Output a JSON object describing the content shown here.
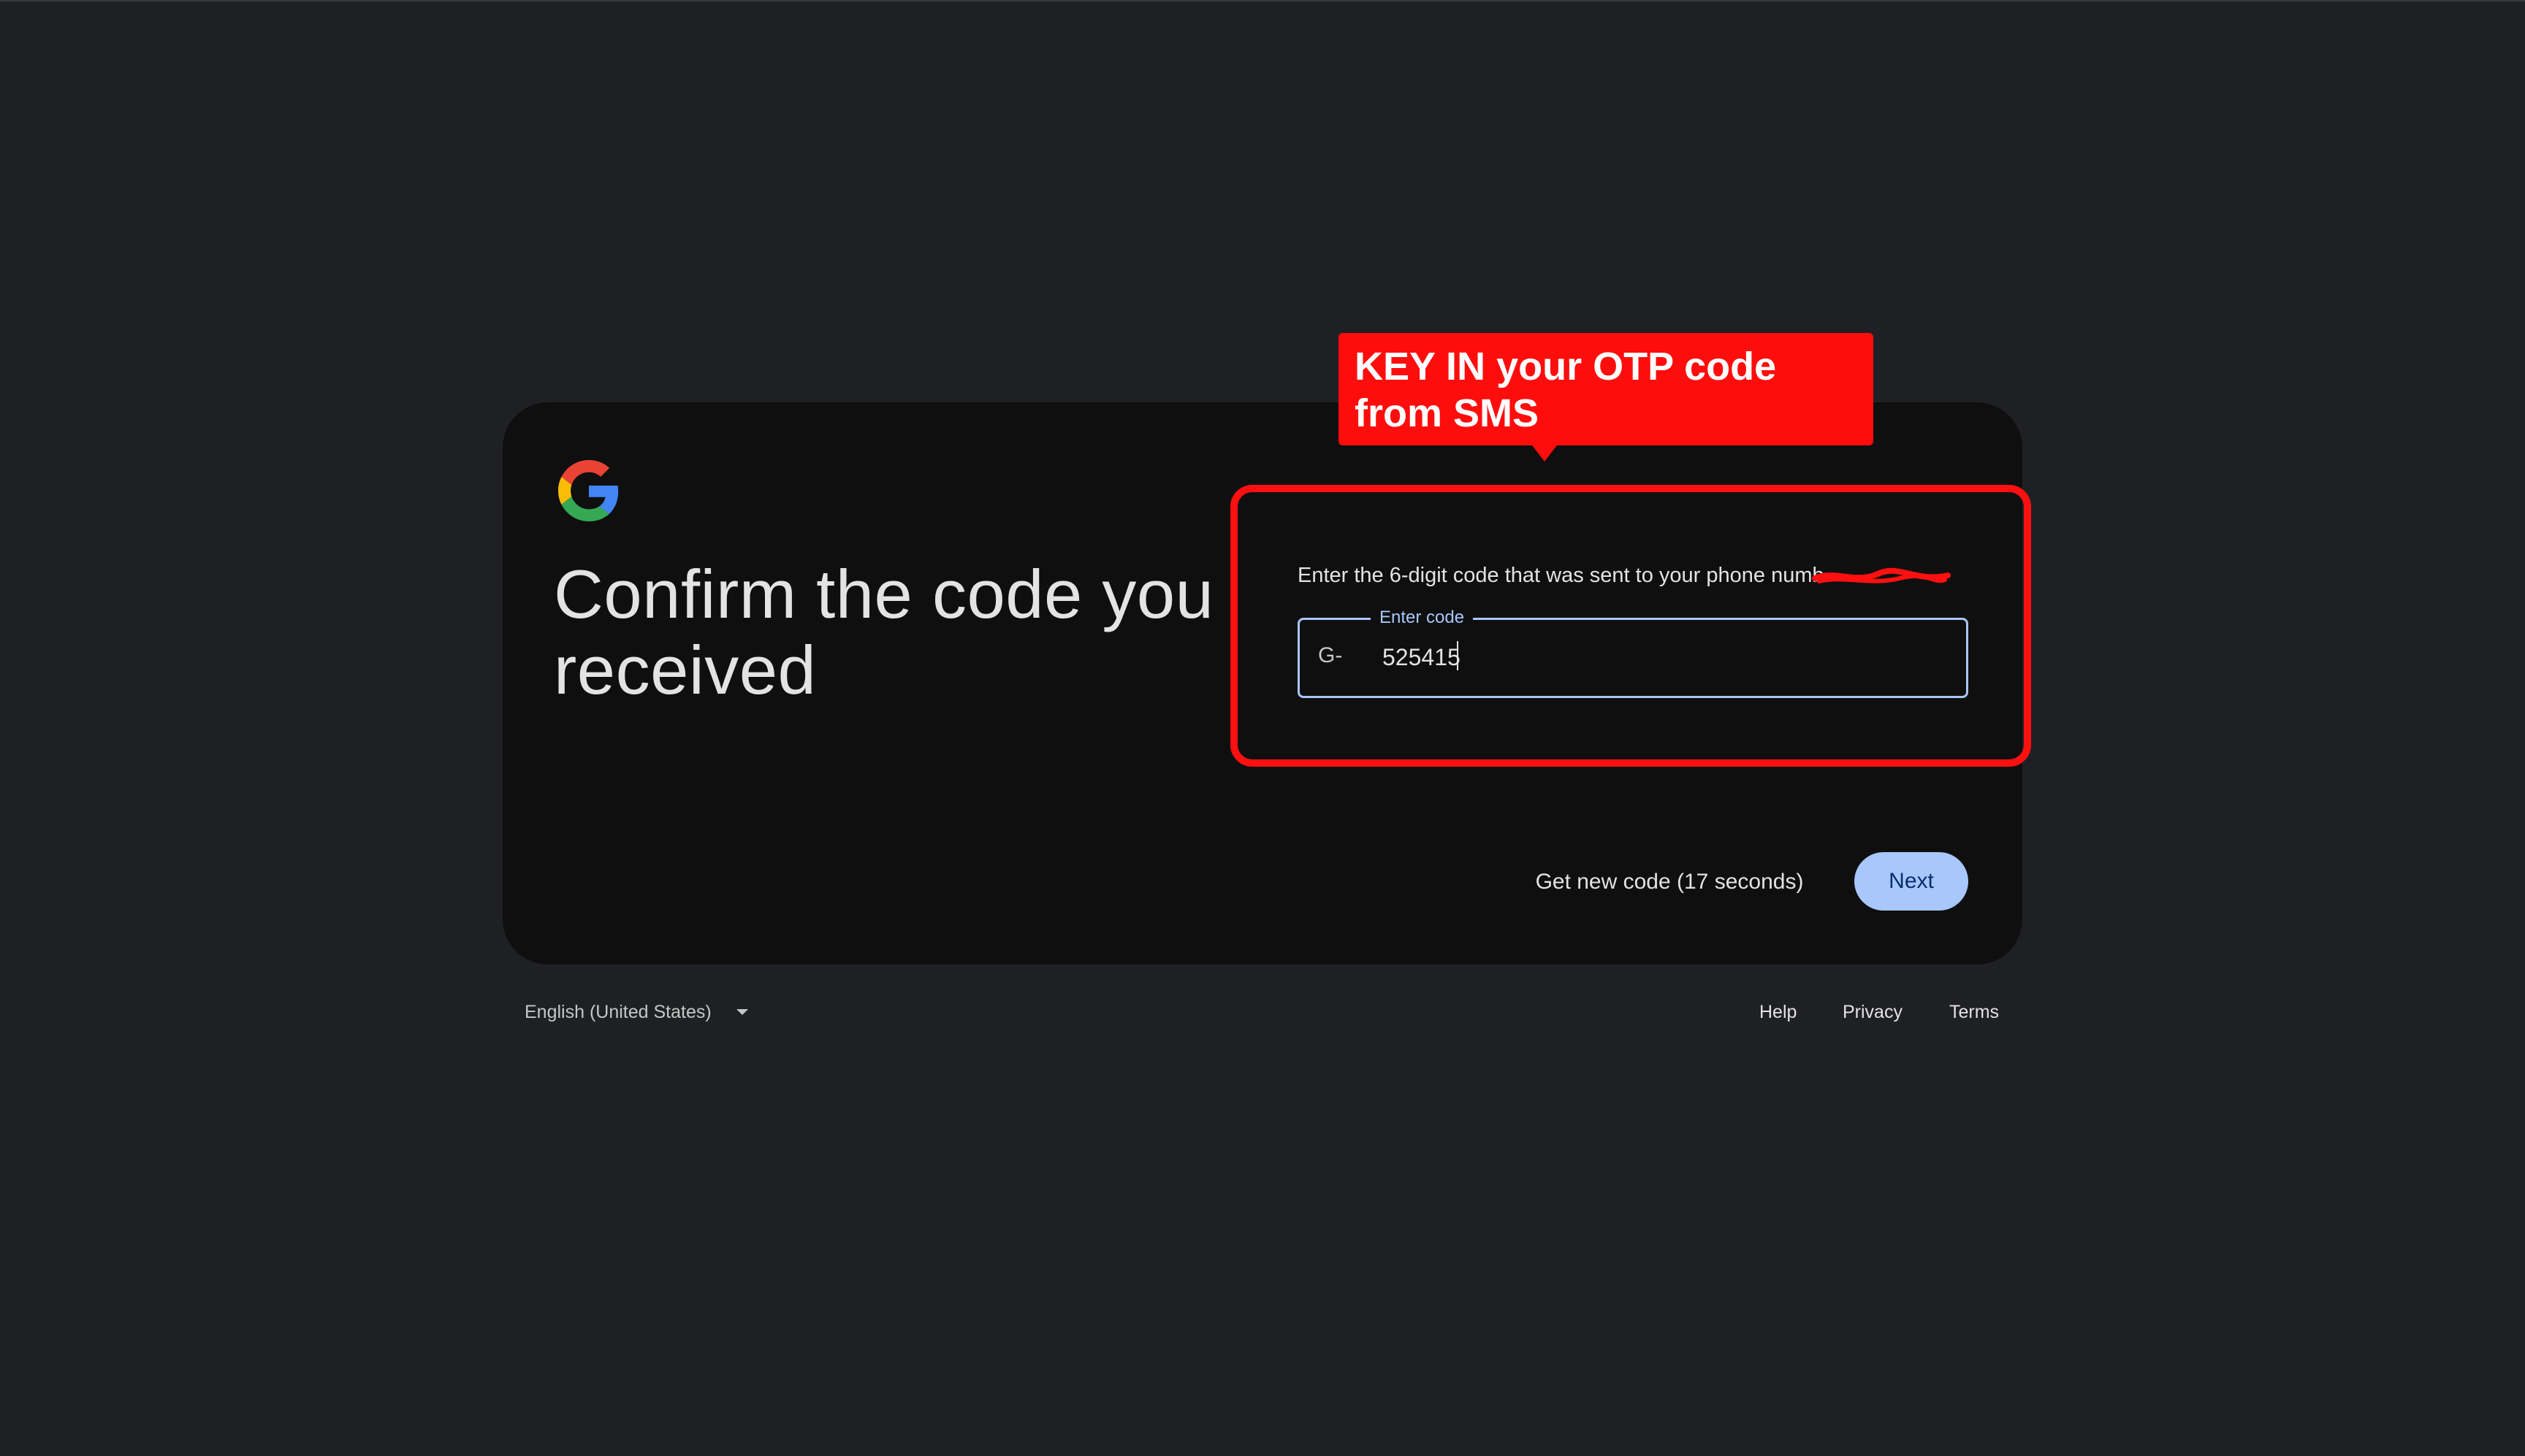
{
  "card": {
    "title": "Confirm the code you received",
    "instruction": "Enter the 6-digit code that was sent to your phone numb",
    "field": {
      "label": "Enter code",
      "prefix": "G-",
      "value": "525415"
    },
    "get_new_code_label": "Get new code (17 seconds)",
    "next_label": "Next"
  },
  "annotation": {
    "callout_text": "KEY IN your OTP code from SMS",
    "color": "#ff0d0d"
  },
  "footer": {
    "language": "English (United States)",
    "links": [
      "Help",
      "Privacy",
      "Terms"
    ]
  },
  "colors": {
    "background": "#1f2023",
    "card": "#0f0f10",
    "accent": "#a8c7fa"
  }
}
